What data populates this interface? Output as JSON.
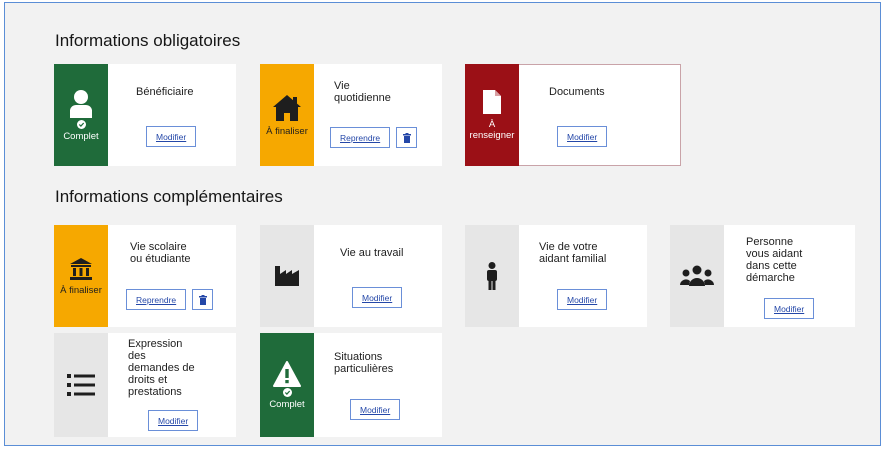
{
  "sections": {
    "mandatory_title": "Informations obligatoires",
    "complementary_title": "Informations complémentaires"
  },
  "cards": {
    "beneficiaire": {
      "title": "Bénéficiaire",
      "status": "Complet",
      "button": "Modifier",
      "icon": "user-icon"
    },
    "vie_quotidienne": {
      "title1": "Vie",
      "title2": "quotidienne",
      "status": "À finaliser",
      "button": "Reprendre",
      "icon": "home-icon"
    },
    "documents": {
      "title": "Documents",
      "status1": "À",
      "status2": "renseigner",
      "button": "Modifier",
      "icon": "document-icon"
    },
    "vie_scolaire": {
      "title1": "Vie scolaire",
      "title2": "ou étudiante",
      "status": "À finaliser",
      "button": "Reprendre",
      "icon": "school-icon"
    },
    "vie_travail": {
      "title": "Vie au travail",
      "button": "Modifier",
      "icon": "factory-icon"
    },
    "aidant_familial": {
      "title1": "Vie de votre",
      "title2": "aidant familial",
      "button": "Modifier",
      "icon": "person-icon"
    },
    "personne_aidant": {
      "title1": "Personne",
      "title2": "vous aidant",
      "title3": "dans cette",
      "title4": "démarche",
      "button": "Modifier",
      "icon": "group-icon"
    },
    "expression": {
      "title1": "Expression",
      "title2": "des",
      "title3": "demandes de",
      "title4": "droits et",
      "title5": "prestations",
      "button": "Modifier",
      "icon": "list-icon"
    },
    "situations": {
      "title1": "Situations",
      "title2": "particulières",
      "status": "Complet",
      "button": "Modifier",
      "icon": "warning-icon"
    }
  },
  "colors": {
    "complete": "#1f6b3a",
    "to_finalize": "#f6a800",
    "to_fill": "#9b1016",
    "neutral": "#e6e6e6",
    "link": "#2447a8"
  }
}
